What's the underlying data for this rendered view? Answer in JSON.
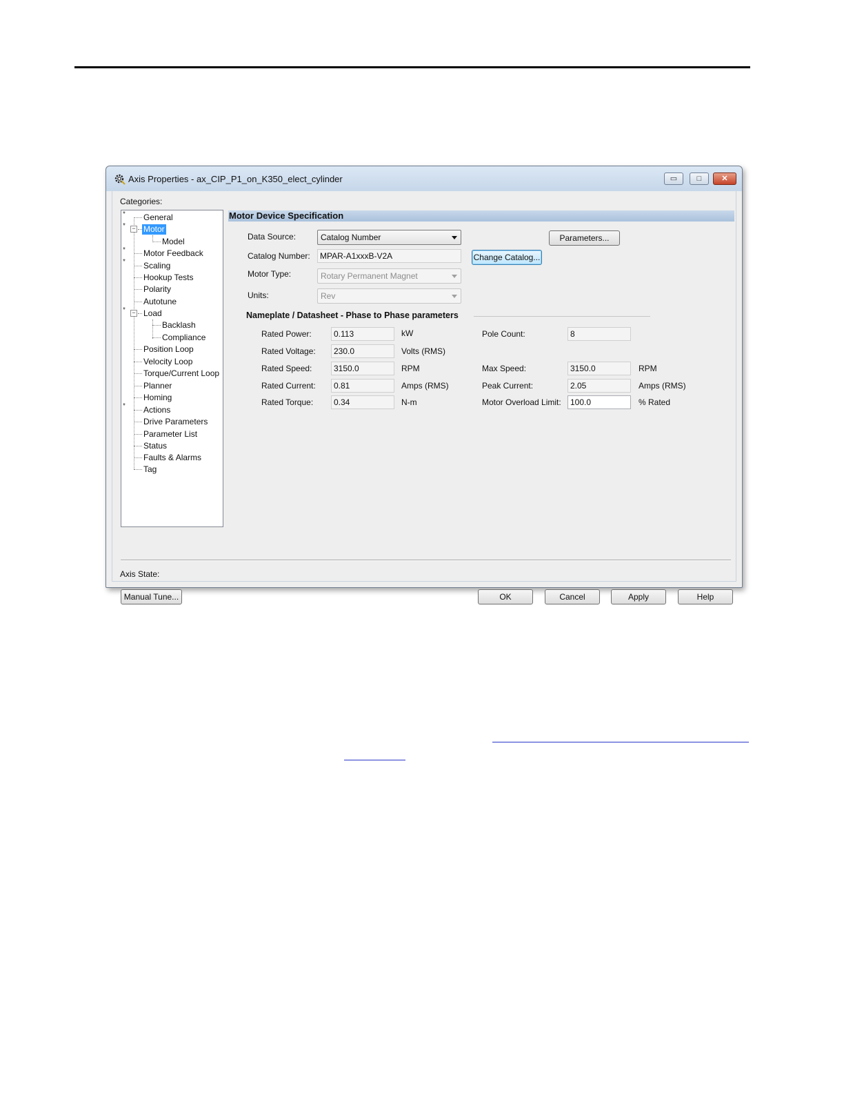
{
  "window": {
    "title": "Axis Properties - ax_CIP_P1_on_K350_elect_cylinder",
    "min_glyph": "▭",
    "max_glyph": "□",
    "close_glyph": "✕",
    "app_icon": "gear-icon"
  },
  "categories_label": "Categories:",
  "tree": {
    "items": [
      {
        "label": "General",
        "star": true
      },
      {
        "label": "Motor",
        "star": true,
        "expanded": true,
        "selected": true
      },
      {
        "label": "Model"
      },
      {
        "label": "Motor Feedback",
        "star": true
      },
      {
        "label": "Scaling",
        "star": true
      },
      {
        "label": "Hookup Tests"
      },
      {
        "label": "Polarity"
      },
      {
        "label": "Autotune"
      },
      {
        "label": "Load",
        "star": true,
        "expanded": true
      },
      {
        "label": "Backlash"
      },
      {
        "label": "Compliance"
      },
      {
        "label": "Position Loop"
      },
      {
        "label": "Velocity Loop"
      },
      {
        "label": "Torque/Current Loop"
      },
      {
        "label": "Planner"
      },
      {
        "label": "Homing"
      },
      {
        "label": "Actions",
        "star": true
      },
      {
        "label": "Drive Parameters"
      },
      {
        "label": "Parameter List"
      },
      {
        "label": "Status"
      },
      {
        "label": "Faults & Alarms"
      },
      {
        "label": "Tag"
      }
    ],
    "star_glyph": "*",
    "minus_glyph": "−"
  },
  "section": {
    "title": "Motor Device Specification",
    "data_source_label": "Data Source:",
    "data_source_value": "Catalog Number",
    "parameters_button": "Parameters...",
    "catalog_number_label": "Catalog Number:",
    "catalog_number_value": "MPAR-A1xxxB-V2A",
    "change_catalog_button": "Change Catalog...",
    "motor_type_label": "Motor Type:",
    "motor_type_value": "Rotary Permanent Magnet",
    "units_label": "Units:",
    "units_value": "Rev"
  },
  "nameplate": {
    "title": "Nameplate / Datasheet - Phase to Phase parameters",
    "rated_power_label": "Rated Power:",
    "rated_power_value": "0.113",
    "rated_power_unit": "kW",
    "rated_voltage_label": "Rated Voltage:",
    "rated_voltage_value": "230.0",
    "rated_voltage_unit": "Volts (RMS)",
    "rated_speed_label": "Rated Speed:",
    "rated_speed_value": "3150.0",
    "rated_speed_unit": "RPM",
    "rated_current_label": "Rated Current:",
    "rated_current_value": "0.81",
    "rated_current_unit": "Amps (RMS)",
    "rated_torque_label": "Rated Torque:",
    "rated_torque_value": "0.34",
    "rated_torque_unit": "N-m",
    "pole_count_label": "Pole Count:",
    "pole_count_value": "8",
    "max_speed_label": "Max Speed:",
    "max_speed_value": "3150.0",
    "max_speed_unit": "RPM",
    "peak_current_label": "Peak Current:",
    "peak_current_value": "2.05",
    "peak_current_unit": "Amps (RMS)",
    "overload_label": "Motor Overload Limit:",
    "overload_value": "100.0",
    "overload_unit": "% Rated"
  },
  "footer": {
    "axis_state_label": "Axis State:",
    "manual_tune_button": "Manual Tune...",
    "ok_button": "OK",
    "cancel_button": "Cancel",
    "apply_button": "Apply",
    "help_button": "Help"
  }
}
